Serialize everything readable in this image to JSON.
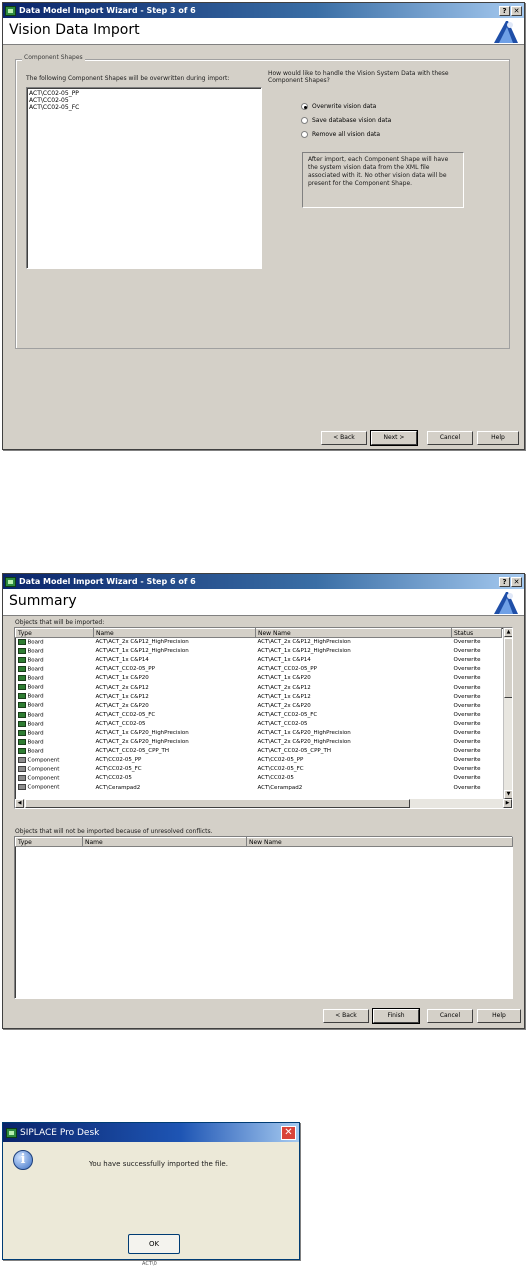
{
  "step3": {
    "title_bar": "Data Model Import Wizard - Step 3 of 6",
    "header": "Vision Data Import",
    "group_label": "Component Shapes",
    "list_caption": "The following Component Shapes will be overwritten during import:",
    "items": [
      "ACT\\CC02-05_PP",
      "ACT\\CC02-05",
      "ACT\\CC02-05_FC"
    ],
    "question": "How would like to handle the Vision System Data with these Component Shapes?",
    "options": [
      "Overwrite vision data",
      "Save database vision data",
      "Remove all vision data"
    ],
    "selected_option": "Overwrite vision data",
    "info": "After import, each Component Shape will have the system vision data from the XML file associated with it. No other vision data will be present for the Component Shape.",
    "buttons": {
      "back": "< Back",
      "next": "Next >",
      "cancel": "Cancel",
      "help": "Help"
    }
  },
  "step6": {
    "title_bar": "Data Model Import Wizard - Step 6 of 6",
    "header": "Summary",
    "imported_label": "Objects that will be imported:",
    "columns": [
      "Type",
      "Name",
      "New Name",
      "Status"
    ],
    "rows": [
      {
        "type": "Board",
        "icon": "board-icon",
        "name": "ACT\\ACT_2x C&P12_HighPrecision",
        "new_name": "ACT\\ACT_2x C&P12_HighPrecision",
        "status": "Overwrite"
      },
      {
        "type": "Board",
        "icon": "board-icon",
        "name": "ACT\\ACT_1x C&P12_HighPrecision",
        "new_name": "ACT\\ACT_1x C&P12_HighPrecision",
        "status": "Overwrite"
      },
      {
        "type": "Board",
        "icon": "board-icon",
        "name": "ACT\\ACT_1x C&P14",
        "new_name": "ACT\\ACT_1x C&P14",
        "status": "Overwrite"
      },
      {
        "type": "Board",
        "icon": "board-icon",
        "name": "ACT\\ACT_CC02-05_PP",
        "new_name": "ACT\\ACT_CC02-05_PP",
        "status": "Overwrite"
      },
      {
        "type": "Board",
        "icon": "board-icon",
        "name": "ACT\\ACT_1x C&P20",
        "new_name": "ACT\\ACT_1x C&P20",
        "status": "Overwrite"
      },
      {
        "type": "Board",
        "icon": "board-icon",
        "name": "ACT\\ACT_2x C&P12",
        "new_name": "ACT\\ACT_2x C&P12",
        "status": "Overwrite"
      },
      {
        "type": "Board",
        "icon": "board-icon",
        "name": "ACT\\ACT_1x C&P12",
        "new_name": "ACT\\ACT_1x C&P12",
        "status": "Overwrite"
      },
      {
        "type": "Board",
        "icon": "board-icon",
        "name": "ACT\\ACT_2x C&P20",
        "new_name": "ACT\\ACT_2x C&P20",
        "status": "Overwrite"
      },
      {
        "type": "Board",
        "icon": "board-icon",
        "name": "ACT\\ACT_CC02-05_FC",
        "new_name": "ACT\\ACT_CC02-05_FC",
        "status": "Overwrite"
      },
      {
        "type": "Board",
        "icon": "board-icon",
        "name": "ACT\\ACT_CC02-05",
        "new_name": "ACT\\ACT_CC02-05",
        "status": "Overwrite"
      },
      {
        "type": "Board",
        "icon": "board-icon",
        "name": "ACT\\ACT_1x C&P20_HighPrecision",
        "new_name": "ACT\\ACT_1x C&P20_HighPrecision",
        "status": "Overwrite"
      },
      {
        "type": "Board",
        "icon": "board-icon",
        "name": "ACT\\ACT_2x C&P20_HighPrecision",
        "new_name": "ACT\\ACT_2x C&P20_HighPrecision",
        "status": "Overwrite"
      },
      {
        "type": "Board",
        "icon": "board-icon",
        "name": "ACT\\ACT_CC02-05_CPP_TH",
        "new_name": "ACT\\ACT_CC02-05_CPP_TH",
        "status": "Overwrite"
      },
      {
        "type": "Component",
        "icon": "component-icon",
        "name": "ACT\\CC02-05_PP",
        "new_name": "ACT\\CC02-05_PP",
        "status": "Overwrite"
      },
      {
        "type": "Component",
        "icon": "component-icon",
        "name": "ACT\\CC02-05_FC",
        "new_name": "ACT\\CC02-05_FC",
        "status": "Overwrite"
      },
      {
        "type": "Component",
        "icon": "component-icon",
        "name": "ACT\\CC02-05",
        "new_name": "ACT\\CC02-05",
        "status": "Overwrite"
      },
      {
        "type": "Component",
        "icon": "component-icon",
        "name": "ACT\\Cerampad2",
        "new_name": "ACT\\Cerampad2",
        "status": "Overwrite"
      }
    ],
    "conflicts_label": "Objects that will not be imported because of unresolved conflicts.",
    "conflict_columns": [
      "Type",
      "Name",
      "New Name"
    ],
    "buttons": {
      "back": "< Back",
      "finish": "Finish",
      "cancel": "Cancel",
      "help": "Help"
    }
  },
  "dialog": {
    "title": "SIPLACE Pro Desk",
    "message": "You have successfully imported the file.",
    "ok": "OK",
    "caption_below": "ACT\\0"
  },
  "colors": {
    "title_bar": "#0a246a",
    "window_face": "#d4d0c8",
    "board_icon": "#2e7d32"
  }
}
